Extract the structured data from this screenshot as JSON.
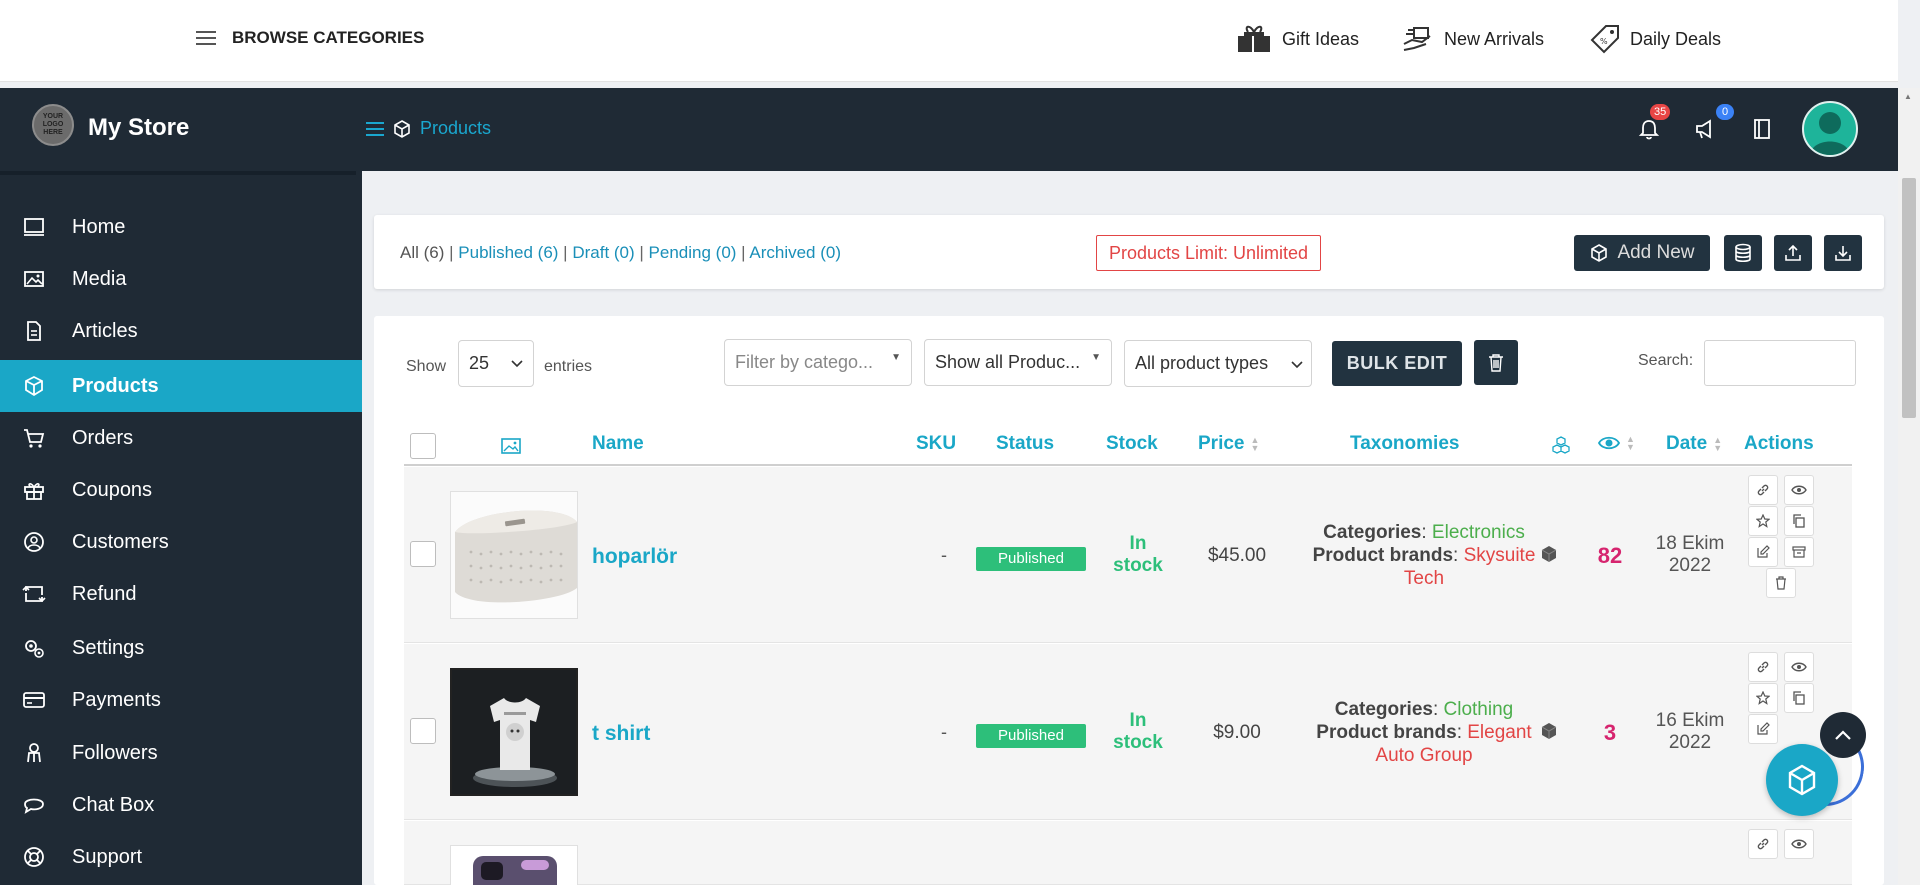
{
  "topbar": {
    "browse_label": "BROWSE CATEGORIES",
    "links": [
      {
        "label": "Gift Ideas",
        "icon": "gift-icon"
      },
      {
        "label": "New Arrivals",
        "icon": "delivery-hand-icon"
      },
      {
        "label": "Daily Deals",
        "icon": "discount-tag-icon"
      }
    ]
  },
  "header": {
    "logo_text": "YOUR LOGO HERE",
    "store_name": "My Store",
    "breadcrumb": "Products",
    "notifications_count": "35",
    "announcements_count": "0",
    "colors": {
      "header_bg": "#1f2a35",
      "accent": "#1aa7c7",
      "badge_red": "#e84545",
      "badge_blue": "#3b82f6"
    }
  },
  "sidebar": {
    "items": [
      {
        "label": "Home",
        "icon": "monitor-icon"
      },
      {
        "label": "Media",
        "icon": "image-icon"
      },
      {
        "label": "Articles",
        "icon": "document-icon"
      },
      {
        "label": "Products",
        "icon": "cube-icon",
        "active": true
      },
      {
        "label": "Orders",
        "icon": "cart-icon"
      },
      {
        "label": "Coupons",
        "icon": "gift-box-icon"
      },
      {
        "label": "Customers",
        "icon": "user-circle-icon"
      },
      {
        "label": "Refund",
        "icon": "refund-icon"
      },
      {
        "label": "Settings",
        "icon": "gears-icon"
      },
      {
        "label": "Payments",
        "icon": "credit-card-icon"
      },
      {
        "label": "Followers",
        "icon": "user-badge-icon"
      },
      {
        "label": "Chat Box",
        "icon": "chat-icon"
      },
      {
        "label": "Support",
        "icon": "lifebuoy-icon"
      }
    ]
  },
  "filters": {
    "all": "All (6)",
    "published": "Published (6)",
    "draft": "Draft (0)",
    "pending": "Pending (0)",
    "archived": "Archived (0)",
    "limit": "Products Limit: Unlimited",
    "add_new": "Add New"
  },
  "controls": {
    "show_label": "Show",
    "entries_value": "25",
    "entries_label": "entries",
    "category_placeholder": "Filter by catego...",
    "products_filter": "Show all Produc...",
    "product_types": "All product types",
    "bulk_edit": "BULK EDIT",
    "search_label": "Search:"
  },
  "table": {
    "headers": {
      "name": "Name",
      "sku": "SKU",
      "status": "Status",
      "stock": "Stock",
      "price": "Price",
      "taxonomies": "Taxonomies",
      "date": "Date",
      "actions": "Actions"
    },
    "categories_label": "Categories",
    "brands_label": "Product brands",
    "rows": [
      {
        "name": "hoparlör",
        "sku": "-",
        "status": "Published",
        "stock_line1": "In",
        "stock_line2": "stock",
        "price": "$45.00",
        "category": "Electronics",
        "brand_line1": "Skysuite",
        "brand_line2": "Tech",
        "views": "82",
        "date_line1": "18 Ekim",
        "date_line2": "2022"
      },
      {
        "name": "t shirt",
        "sku": "-",
        "status": "Published",
        "stock_line1": "In",
        "stock_line2": "stock",
        "price": "$9.00",
        "category": "Clothing",
        "brand_line1": "Elegant",
        "brand_line2": "Auto Group",
        "views": "3",
        "date_line1": "16 Ekim",
        "date_line2": "2022"
      }
    ]
  }
}
